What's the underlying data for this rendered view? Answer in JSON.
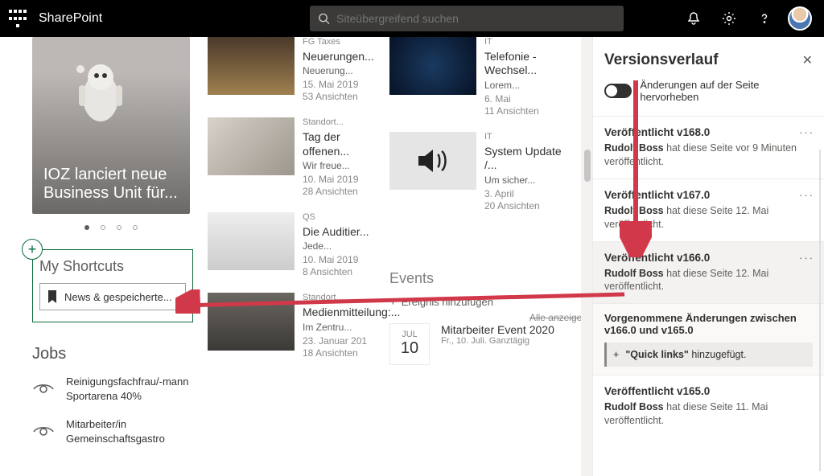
{
  "header": {
    "brand": "SharePoint",
    "search_placeholder": "Siteübergreifend suchen"
  },
  "hero": {
    "title": "IOZ lanciert neue Business Unit für..."
  },
  "shortcuts": {
    "heading": "My Shortcuts",
    "item1": "News & gespeicherte..."
  },
  "jobs": {
    "heading": "Jobs",
    "items": [
      "Reinigungsfachfrau/-mann Sportarena 40%",
      "Mitarbeiter/in Gemeinschaftsgastro"
    ]
  },
  "news": [
    {
      "cat": "FG Taxes",
      "title": "Neuerungen...",
      "desc": "Neuerung...",
      "date": "15. Mai 2019",
      "views": "53 Ansichten"
    },
    {
      "cat": "Standort...",
      "title": "Tag der offenen...",
      "desc": "Wir freue...",
      "date": "10. Mai 2019",
      "views": "28 Ansichten"
    },
    {
      "cat": "QS",
      "title": "Die Auditier...",
      "desc": "Jede...",
      "date": "10. Mai 2019",
      "views": "8 Ansichten"
    },
    {
      "cat": "Standort...",
      "title": "Medienmitteilung:...",
      "desc": "Im Zentru...",
      "date": "23. Januar 201",
      "views": "18 Ansichten"
    }
  ],
  "col3": [
    {
      "cat": "IT",
      "title": "Telefonie - Wechsel...",
      "desc": "Lorem...",
      "date": "6. Mai",
      "views": "11 Ansichten"
    },
    {
      "cat": "IT",
      "title": "System Update /...",
      "desc": "Um sicher...",
      "date": "3. April",
      "views": "20 Ansichten"
    }
  ],
  "events": {
    "heading": "Events",
    "showall": "Alle anzeigen",
    "add": "Ereignis hinzufügen",
    "item": {
      "month": "JUL",
      "day": "10",
      "title": "Mitarbeiter Event 2020",
      "sub": "Fr., 10. Juli. Ganztägig"
    }
  },
  "panel": {
    "title": "Versionsverlauf",
    "toggle_label": "Änderungen auf der Seite hervorheben",
    "versions": [
      {
        "title": "Veröffentlicht v168.0",
        "detail_pre": "Rudolf Boss",
        "detail_post": " hat diese Seite vor 9 Minuten veröffentlicht."
      },
      {
        "title": "Veröffentlicht v167.0",
        "detail_pre": "Rudolf Boss",
        "detail_post": " hat diese Seite 12. Mai veröffentlicht."
      },
      {
        "title": "Veröffentlicht v166.0",
        "detail_pre": "Rudolf Boss",
        "detail_post": " hat diese Seite 12. Mai veröffentlicht."
      }
    ],
    "changes_title": "Vorgenommene Änderungen zwischen v166.0 und v165.0",
    "change_item_bold": "\"Quick links\"",
    "change_item_rest": " hinzugefügt.",
    "v165": {
      "title": "Veröffentlicht v165.0",
      "detail_pre": "Rudolf Boss",
      "detail_post": " hat diese Seite 11. Mai veröffentlicht."
    }
  }
}
